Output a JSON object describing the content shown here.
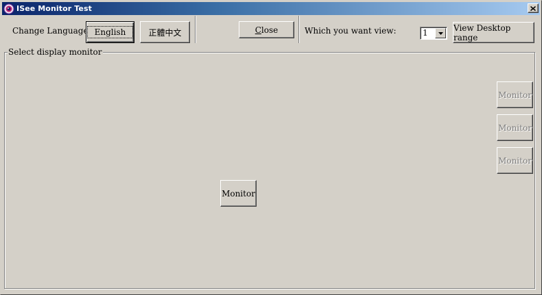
{
  "window": {
    "title": "ISee Monitor Test",
    "icon": "eye-app-icon",
    "close_glyph": "×"
  },
  "toolbar": {
    "change_language_label": "Change Language",
    "english_button": "English",
    "chinese_button": "正體中文",
    "close_button_prefix": "C",
    "close_button_rest": "lose",
    "which_view_label": "Which you want view:",
    "monitor_select_value": "1",
    "view_desktop_button": "View Desktop range"
  },
  "group": {
    "title": "Select display monitor",
    "monitors": [
      {
        "label": "Monitor",
        "enabled": true
      },
      {
        "label": "Monitor",
        "enabled": false
      },
      {
        "label": "Monitor",
        "enabled": false
      },
      {
        "label": "Monitor",
        "enabled": false
      }
    ]
  },
  "colors": {
    "face": "#d4d0c8",
    "title_start": "#0a246a",
    "title_end": "#a6caf0",
    "disabled_text": "#808080"
  }
}
